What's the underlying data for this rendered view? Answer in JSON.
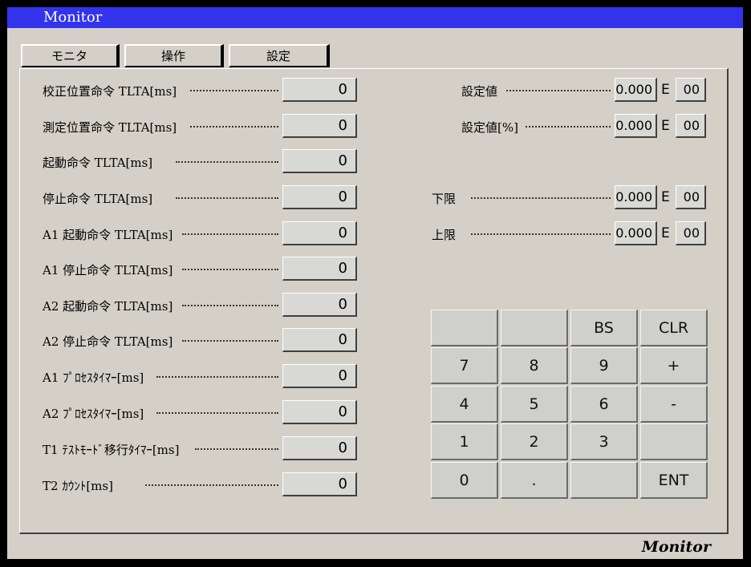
{
  "window": {
    "title": "Monitor"
  },
  "tabs": [
    {
      "label": "モニタ"
    },
    {
      "label": "操作"
    },
    {
      "label": "設定"
    }
  ],
  "left_fields": [
    {
      "label": "校正位置命令 TLTA[ms]",
      "value": "0"
    },
    {
      "label": "測定位置命令 TLTA[ms]",
      "value": "0"
    },
    {
      "label": "起動命令 TLTA[ms]",
      "value": "0"
    },
    {
      "label": "停止命令 TLTA[ms]",
      "value": "0"
    },
    {
      "label": "A1 起動命令 TLTA[ms]",
      "value": "0"
    },
    {
      "label": "A1 停止命令 TLTA[ms]",
      "value": "0"
    },
    {
      "label": "A2 起動命令 TLTA[ms]",
      "value": "0"
    },
    {
      "label": "A2 停止命令 TLTA[ms]",
      "value": "0"
    },
    {
      "label": "A1 ﾌﾟﾛｾｽﾀｲﾏｰ[ms]",
      "value": "0"
    },
    {
      "label": "A2 ﾌﾟﾛｾｽﾀｲﾏｰ[ms]",
      "value": "0"
    },
    {
      "label": "T1 ﾃｽﾄﾓｰﾄﾞ移行ﾀｲﾏｰ[ms]",
      "value": "0"
    },
    {
      "label": "T2 ｶｳﾝﾄ[ms]",
      "value": "0"
    }
  ],
  "right_fields": [
    {
      "label": "設定値",
      "mantissa": "0.000",
      "e": "E",
      "exponent": "00"
    },
    {
      "label": "設定値[%]",
      "mantissa": "0.000",
      "e": "E",
      "exponent": "00"
    },
    {
      "label": "下限",
      "mantissa": "0.000",
      "e": "E",
      "exponent": "00"
    },
    {
      "label": "上限",
      "mantissa": "0.000",
      "e": "E",
      "exponent": "00"
    }
  ],
  "keypad": [
    [
      "",
      "",
      "BS",
      "CLR"
    ],
    [
      "7",
      "8",
      "9",
      "+"
    ],
    [
      "4",
      "5",
      "6",
      "-"
    ],
    [
      "1",
      "2",
      "3",
      ""
    ],
    [
      "0",
      ".",
      "",
      "ENT"
    ]
  ],
  "footer": {
    "label": "Monitor"
  }
}
